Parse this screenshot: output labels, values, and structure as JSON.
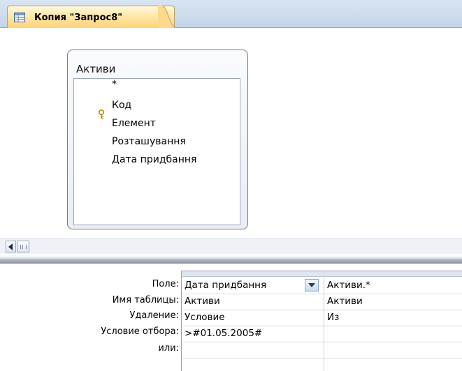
{
  "tab": {
    "title": "Копия \"Запрос8\"",
    "icon": "query-datasheet-icon"
  },
  "table_box": {
    "name": "Активи",
    "fields": [
      "*",
      "Код",
      "Елемент",
      "Розташування",
      "Дата придбання"
    ],
    "key_field_icon": "primary-key-icon"
  },
  "scrollbar": {
    "left_arrow_icon": "arrow-left-icon",
    "thumb_icon": "scroll-thumb-grip-icon"
  },
  "grid": {
    "row_labels": [
      "Поле:",
      "Имя таблицы:",
      "Удаление:",
      "Условие отбора:",
      "или:"
    ],
    "columns": [
      {
        "field": "Дата придбання",
        "table": "Активи",
        "delete": "Условие",
        "criteria": ">#01.05.2005#",
        "or": ""
      },
      {
        "field": "Активи.*",
        "table": "Активи",
        "delete": "Из",
        "criteria": "",
        "or": ""
      }
    ]
  },
  "colors": {
    "tab_active": "#fdd27a",
    "tabstrip_bg": "#c4d4e8",
    "grid_line": "#9aa3af"
  }
}
